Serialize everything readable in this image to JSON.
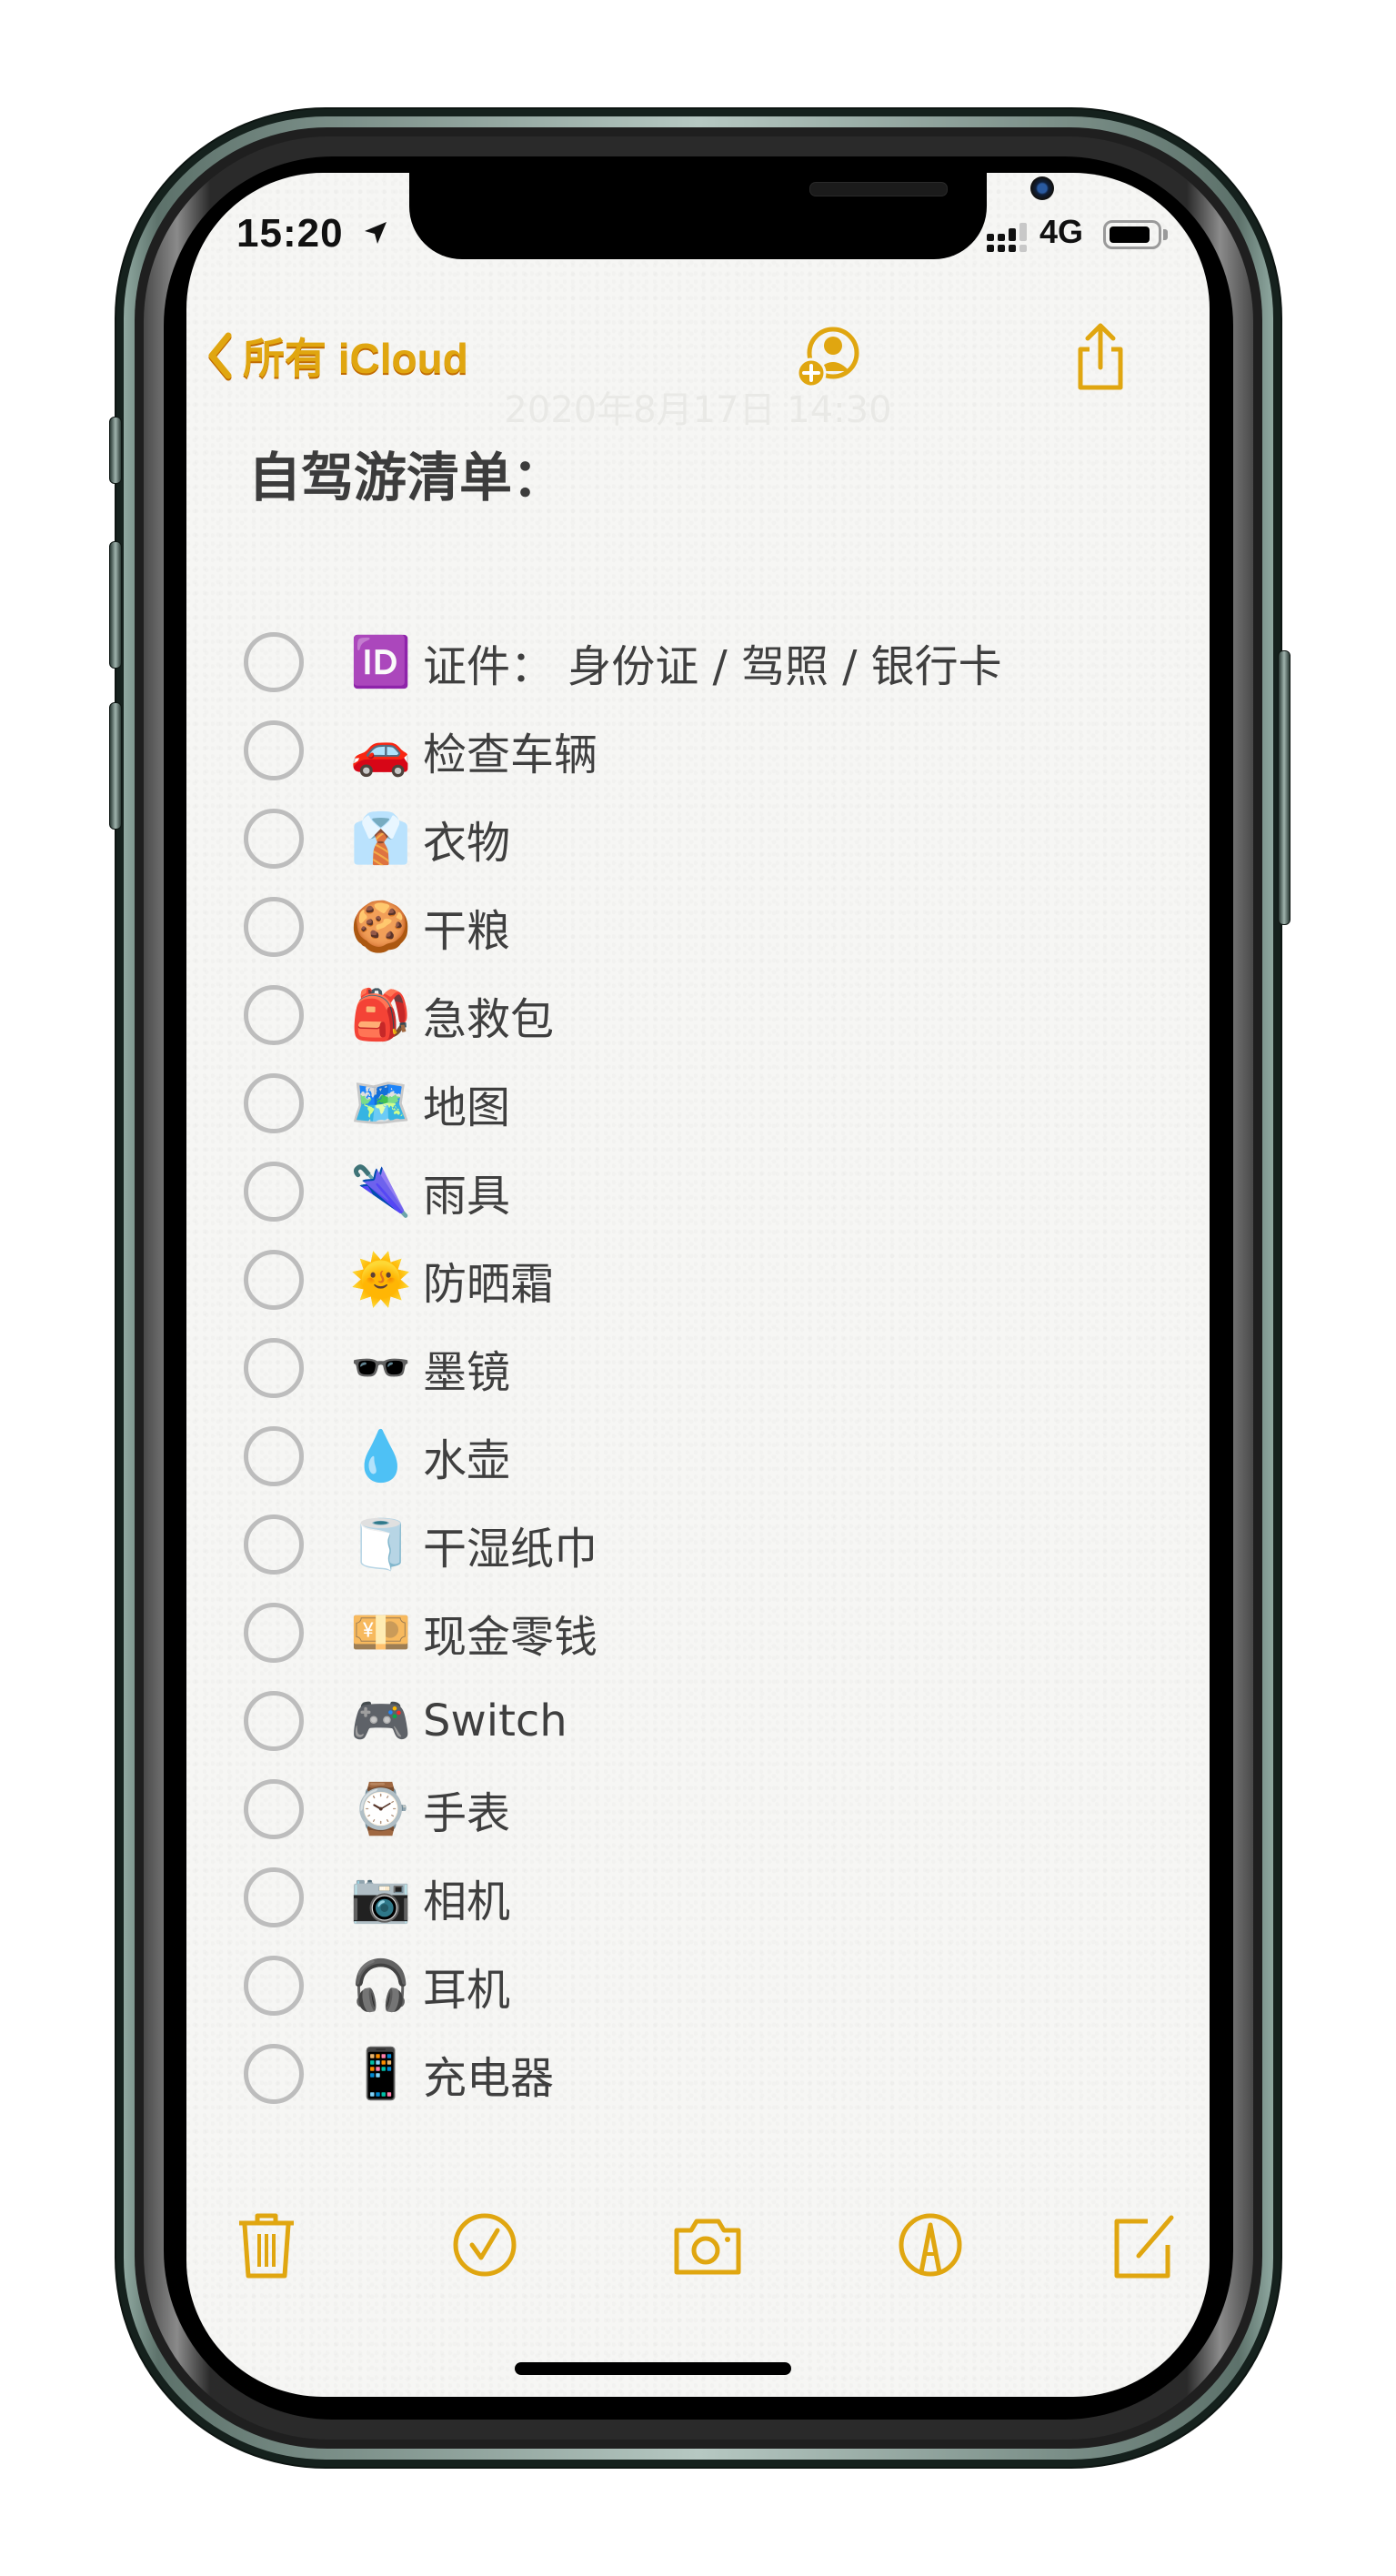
{
  "status_bar": {
    "time": "15:20",
    "location_icon": "location-arrow-icon",
    "signal_icon": "cellular-signal-icon",
    "network": "4G",
    "battery_icon": "battery-icon"
  },
  "nav": {
    "back_label": "所有 iCloud",
    "back_icon": "chevron-left-icon",
    "add_people_icon": "add-person-icon",
    "share_icon": "share-icon"
  },
  "note": {
    "date": "2020年8月17日 14:30",
    "title": "自驾游清单：",
    "items": [
      {
        "emoji": "🆔",
        "icon": "id-icon",
        "text": "证件： 身份证 / 驾照 /  银行卡",
        "checked": false
      },
      {
        "emoji": "🚗",
        "icon": "car-icon",
        "text": "检查车辆",
        "checked": false
      },
      {
        "emoji": "👔",
        "icon": "shirt-tie-icon",
        "text": "衣物",
        "checked": false
      },
      {
        "emoji": "🍪",
        "icon": "cookie-icon",
        "text": "干粮",
        "checked": false
      },
      {
        "emoji": "🎒",
        "icon": "backpack-icon",
        "text": "急救包",
        "checked": false
      },
      {
        "emoji": "🗺️",
        "icon": "world-map-icon",
        "text": "地图",
        "checked": false
      },
      {
        "emoji": "🌂",
        "icon": "umbrella-icon",
        "text": "雨具",
        "checked": false
      },
      {
        "emoji": "🌞",
        "icon": "sun-face-icon",
        "text": "防晒霜",
        "checked": false
      },
      {
        "emoji": "🕶️",
        "icon": "sunglasses-icon",
        "text": "墨镜",
        "checked": false
      },
      {
        "emoji": "💧",
        "icon": "droplet-icon",
        "text": "水壶",
        "checked": false
      },
      {
        "emoji": "🧻",
        "icon": "toilet-paper-icon",
        "text": "干湿纸巾",
        "checked": false
      },
      {
        "emoji": "💴",
        "icon": "yen-banknote-icon",
        "text": "现金零钱",
        "checked": false
      },
      {
        "emoji": "🎮",
        "icon": "game-controller-icon",
        "text": "Switch",
        "checked": false
      },
      {
        "emoji": "⌚",
        "icon": "watch-icon",
        "text": "手表",
        "checked": false
      },
      {
        "emoji": "📷",
        "icon": "camera-icon",
        "text": "相机",
        "checked": false
      },
      {
        "emoji": "🎧",
        "icon": "headphones-icon",
        "text": "耳机",
        "checked": false
      },
      {
        "emoji": "📱",
        "icon": "mobile-phone-icon",
        "text": "充电器",
        "checked": false
      }
    ]
  },
  "toolbar": {
    "items": [
      "trash-icon",
      "checklist-icon",
      "camera-icon",
      "markup-icon",
      "compose-icon"
    ]
  },
  "colors": {
    "accent": "#E0A610",
    "accent_shadow": "#C06A00",
    "text": "#3F3F3F",
    "paper": "#F6F6F4",
    "checkbox": "#BDBDBD",
    "frame": "#15211D"
  }
}
